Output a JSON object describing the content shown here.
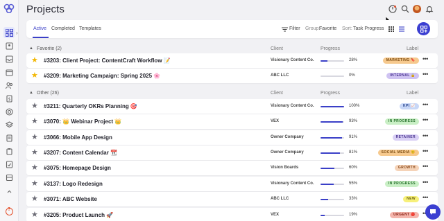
{
  "page": {
    "title": "Projects"
  },
  "toolbar": {
    "tabs": [
      {
        "label": "Active",
        "active": true
      },
      {
        "label": "Completed",
        "active": false
      },
      {
        "label": "Templates",
        "active": false
      }
    ],
    "filter_label": "Filter",
    "group_prefix": "Group:",
    "group_value": "Favorite",
    "sort_prefix": "Sort:",
    "sort_value": "Task Progress"
  },
  "columns": {
    "client": "Client",
    "progress": "Progress",
    "label": "Label"
  },
  "groups": [
    {
      "name": "Favorite (2)",
      "rows": [
        {
          "favorite": true,
          "title": "#3203: Client Project: ContentCraft Workflow 📝",
          "client": "Visionary Content Co.",
          "progress": 28,
          "progress_text": "28%",
          "label": "MARKETING 🔖",
          "label_bg": "#f6c98e",
          "label_fg": "#7a4a10"
        },
        {
          "favorite": true,
          "title": "#3209: Marketing Campaign: Spring 2025 🌸",
          "client": "ABC LLC",
          "progress": 0,
          "progress_text": "0%",
          "label": "INTERNAL 🔒",
          "label_bg": "#cfc3f2",
          "label_fg": "#4b3591"
        }
      ]
    },
    {
      "name": "Other (26)",
      "rows": [
        {
          "favorite": false,
          "title": "#3211: Quarterly OKRs Planning 🎯",
          "client": "Visionary Content Co.",
          "progress": 100,
          "progress_text": "100%",
          "label": "KPI 📈",
          "label_bg": "#c8d7f7",
          "label_fg": "#23408a"
        },
        {
          "favorite": false,
          "title": "#3070: 👑 Webinar Project 👑",
          "client": "VEX",
          "progress": 93,
          "progress_text": "93%",
          "label": "IN PROGRESS",
          "label_bg": "#c9efc5",
          "label_fg": "#24702a"
        },
        {
          "favorite": false,
          "title": "#3066: Mobile App Design",
          "client": "Owner Company",
          "progress": 91,
          "progress_text": "91%",
          "label": "RETAINER",
          "label_bg": "#d9d0f5",
          "label_fg": "#4b3591"
        },
        {
          "favorite": false,
          "title": "#3207: Content Calendar 📆",
          "client": "Owner Company",
          "progress": 81,
          "progress_text": "81%",
          "label": "SOCIAL MEDIA 😊",
          "label_bg": "#f6c98e",
          "label_fg": "#7a4a10"
        },
        {
          "favorite": false,
          "title": "#3075: Homepage Design",
          "client": "Vision Boards",
          "progress": 60,
          "progress_text": "60%",
          "label": "GROWTH",
          "label_bg": "#f5d3b8",
          "label_fg": "#8a4a1c"
        },
        {
          "favorite": false,
          "title": "#3137: Logo Redesign",
          "client": "Visionary Content Co.",
          "progress": 55,
          "progress_text": "55%",
          "label": "IN PROGRESS",
          "label_bg": "#c9efc5",
          "label_fg": "#24702a"
        },
        {
          "favorite": false,
          "title": "#3071: ABC Website",
          "client": "ABC LLC",
          "progress": 33,
          "progress_text": "33%",
          "label": "NEW",
          "label_bg": "#f7f07a",
          "label_fg": "#6b6210"
        },
        {
          "favorite": false,
          "title": "#3205: Product Launch 🚀",
          "client": "VEX",
          "progress": 19,
          "progress_text": "19%",
          "label": "URGENT 🔴",
          "label_bg": "#f4b5ac",
          "label_fg": "#8a2416"
        }
      ]
    }
  ],
  "colors": {
    "accent": "#3a3fc7",
    "star_favorite": "#f2b705",
    "star_default": "#6b6b75"
  }
}
